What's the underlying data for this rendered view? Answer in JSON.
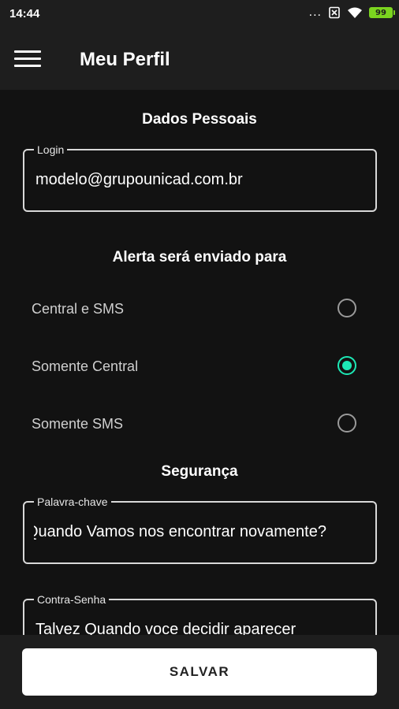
{
  "status_bar": {
    "time": "14:44",
    "dots": "...",
    "battery": "99",
    "icons": [
      "more-dots-icon",
      "sim-none-icon",
      "wifi-icon",
      "battery-icon"
    ],
    "battery_color": "#7bd41f"
  },
  "app_bar": {
    "menu_icon": "hamburger-menu-icon",
    "title": "Meu Perfil"
  },
  "personal": {
    "title": "Dados Pessoais",
    "login_label": "Login",
    "login_value": "modelo@grupounicad.com.br"
  },
  "alert": {
    "title": "Alerta será enviado para",
    "options": [
      {
        "label": "Central e SMS",
        "selected": false
      },
      {
        "label": "Somente Central",
        "selected": true
      },
      {
        "label": "Somente SMS",
        "selected": false
      }
    ],
    "accent_color": "#1de9b6"
  },
  "security": {
    "title": "Segurança",
    "keyword_label": "Palavra-chave",
    "keyword_value": "Quando Vamos nos encontrar novamente?",
    "countersign_label": "Contra-Senha",
    "countersign_value": "Talvez Quando voce decidir aparecer"
  },
  "footer": {
    "save_label": "SALVAR"
  }
}
